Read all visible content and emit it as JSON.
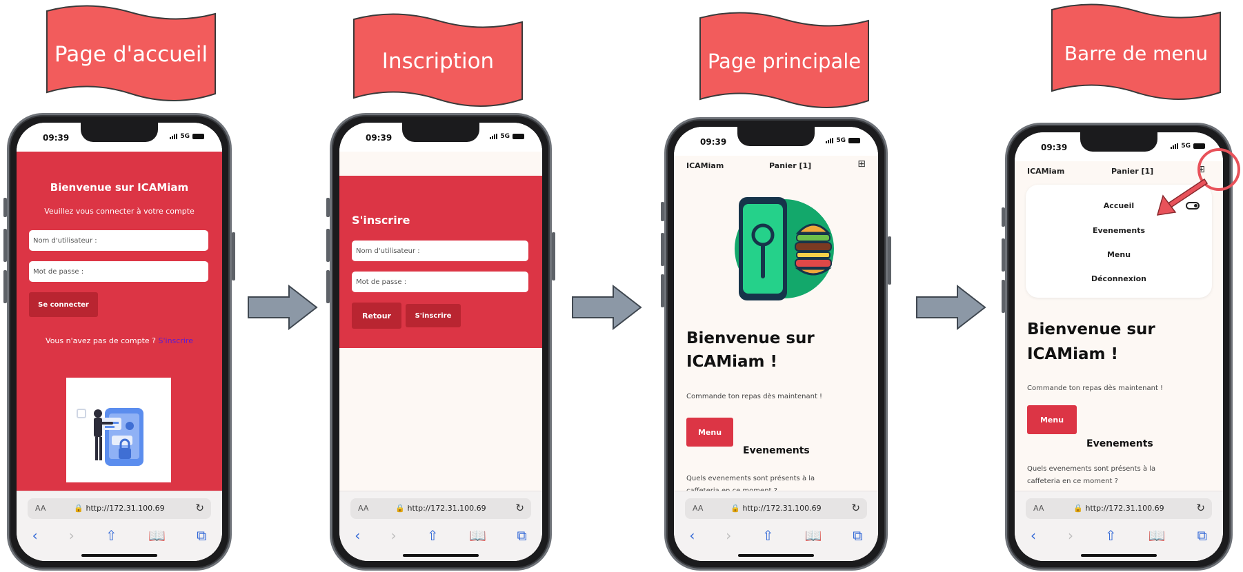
{
  "colors": {
    "banner": "#f25c5c",
    "brand_red": "#dc3545",
    "arrow": "#8c98a6",
    "link_purple": "#5b1bd6"
  },
  "banners": [
    "Page d'accueil",
    "Inscription",
    "Page principale",
    "Barre de menu"
  ],
  "status": {
    "time": "09:39",
    "network": "5G"
  },
  "browser": {
    "aa": "AA",
    "url": "http://172.31.100.69"
  },
  "login": {
    "title": "Bienvenue sur ICAMiam",
    "subtitle": "Veuillez vous connecter à votre compte",
    "username_placeholder": "Nom d'utilisateur :",
    "password_placeholder": "Mot de passe :",
    "connect_label": "Se connecter",
    "no_account_text": "Vous n'avez pas de compte ?",
    "signup_link": "S'inscrire"
  },
  "signup": {
    "title": "S'inscrire",
    "username_placeholder": "Nom d'utilisateur :",
    "password_placeholder": "Mot de passe :",
    "back_label": "Retour",
    "signup_label": "S'inscrire"
  },
  "main": {
    "brand": "ICAMiam",
    "cart": "Panier [1]",
    "heading_line1": "Bienvenue sur",
    "heading_line2": "ICAMiam !",
    "tagline": "Commande ton repas dès maintenant !",
    "menu_button": "Menu",
    "events_heading": "Evenements",
    "events_text_line1": "Quels evenements sont présents à la",
    "events_text_line2": "caffeteria en ce moment ?"
  },
  "menu_bar": {
    "items": [
      "Accueil",
      "Evenements",
      "Menu",
      "Déconnexion"
    ]
  }
}
